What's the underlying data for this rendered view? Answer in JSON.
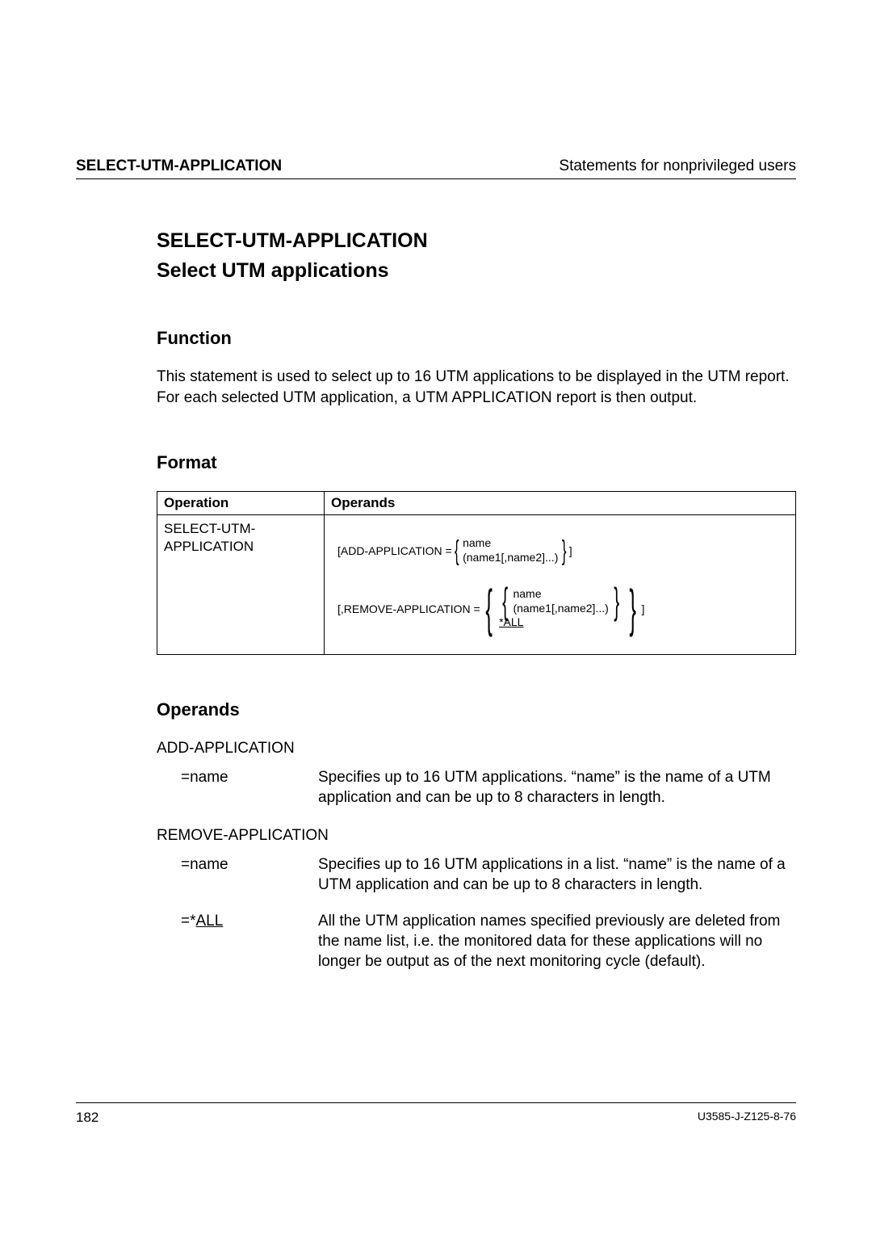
{
  "header": {
    "left": "SELECT-UTM-APPLICATION",
    "right": "Statements for nonprivileged users"
  },
  "title_line1": "SELECT-UTM-APPLICATION",
  "title_line2": "Select UTM applications",
  "function": {
    "heading": "Function",
    "body": "This statement is used to select up to 16 UTM applications to be displayed in the UTM report. For each selected UTM application, a UTM APPLICATION report is then output."
  },
  "format": {
    "heading": "Format",
    "col1": "Operation",
    "col2": "Operands",
    "operation": "SELECT-UTM-\nAPPLICATION",
    "add_label": "[ADD-APPLICATION =",
    "add_opt1": "name",
    "add_opt2": "(name1[,name2]...)",
    "add_close": "]",
    "rem_label": "[,REMOVE-APPLICATION =",
    "rem_opt1": "name",
    "rem_opt2": "(name1[,name2]...)",
    "rem_opt3": "*ALL",
    "rem_close": "]"
  },
  "operands": {
    "heading": "Operands",
    "add_head": "ADD-APPLICATION",
    "add_name_term": "=name",
    "add_name_def": "Specifies up to 16 UTM applications. “name” is the name of a UTM application and can be up to 8 characters in length.",
    "rem_head": "REMOVE-APPLICATION",
    "rem_name_term": "=name",
    "rem_name_def": "Specifies up to 16 UTM applications in a list. “name” is the name of a UTM application and can be up to 8 characters in length.",
    "rem_all_term": "=*ALL",
    "rem_all_def": "All the UTM application names specified previously are deleted from the name list, i.e. the monitored data for these applications will no longer be output as of the next monitoring cycle (default)."
  },
  "footer": {
    "page": "182",
    "docid": "U3585-J-Z125-8-76"
  }
}
